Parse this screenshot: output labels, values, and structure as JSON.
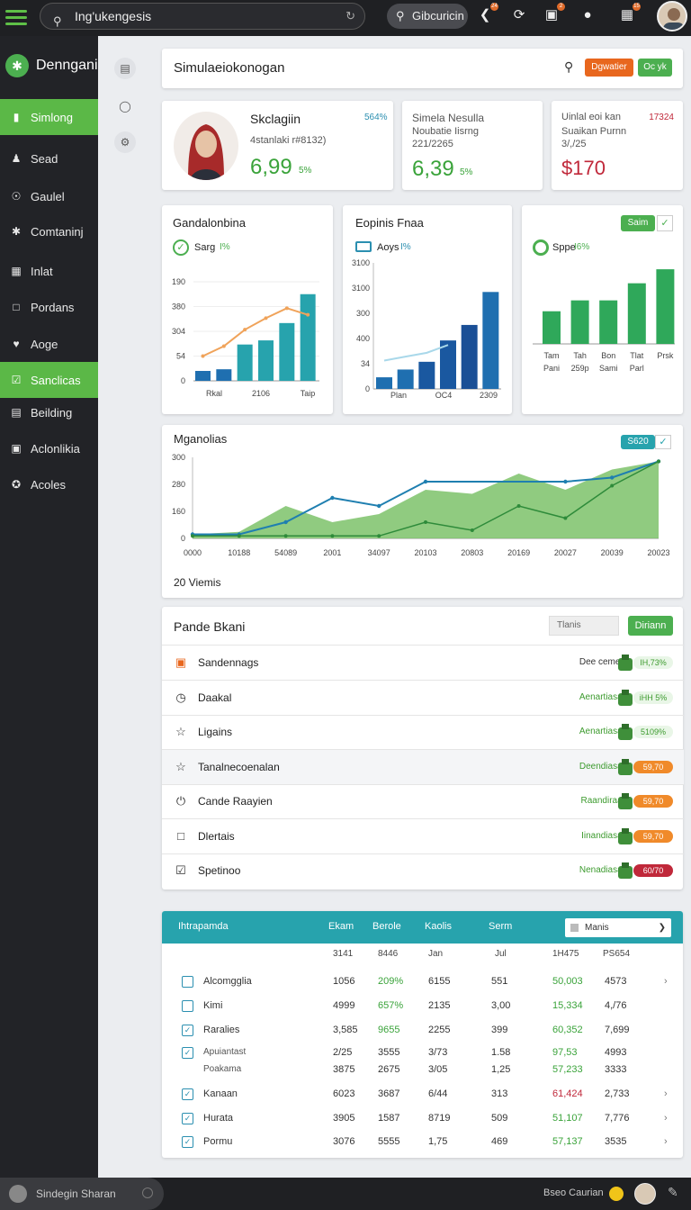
{
  "topbar": {
    "search_value": "Ing'ukengesis",
    "pill_search": "Gibcuricin",
    "badges": [
      "24",
      "2",
      "15",
      "24"
    ]
  },
  "sidebar": {
    "brand": "Denngani",
    "items": [
      {
        "label": "Simlong",
        "icon": "document-icon",
        "active": true
      },
      {
        "label": "Sead",
        "icon": "user-icon",
        "active": false
      },
      {
        "label": "Gaulel",
        "icon": "target-icon",
        "active": false
      },
      {
        "label": "Comtaninj",
        "icon": "gear-icon",
        "active": false
      },
      {
        "label": "Inlat",
        "icon": "grid-icon",
        "active": false
      },
      {
        "label": "Pordans",
        "icon": "square-icon",
        "active": false
      },
      {
        "label": "Aoge",
        "icon": "heart-icon",
        "active": false
      },
      {
        "label": "Sanclicas",
        "icon": "check-icon",
        "active": true
      },
      {
        "label": "Beilding",
        "icon": "chart-icon",
        "active": false
      },
      {
        "label": "Aclonlikia",
        "icon": "image-icon",
        "active": false
      },
      {
        "label": "Acoles",
        "icon": "star-icon",
        "active": false
      }
    ]
  },
  "header": {
    "title": "Simulaeiokonogan",
    "btn_orange": "Dgwatier",
    "btn_green": "Oc yk"
  },
  "stats": [
    {
      "title": "Skclagiin",
      "subtitle": "4stanlaki r#8132)",
      "value": "6,99",
      "pct": "5%",
      "corner": "564%",
      "value_color": "#3aa33a"
    },
    {
      "line1": "Simela Nesulla",
      "line2": "Noubatie Iisrng",
      "line3": "221/2265",
      "value": "6,39",
      "pct": "5%",
      "value_color": "#3aa33a"
    },
    {
      "line1": "Uinlal eoi kan",
      "line2": "Suaikan Purnn",
      "line3": "3/,/25",
      "value": "$170",
      "corner": "17324",
      "value_color": "#c0283a"
    }
  ],
  "chart1": {
    "title": "Gandalonbina",
    "legend": "Sarg",
    "legend_pct": "I%",
    "chart_data": {
      "type": "bar",
      "yticks": [
        "190",
        "380",
        "304",
        "54",
        "0"
      ],
      "xticks": [
        "Rkal",
        "2106",
        "Taip"
      ],
      "values": [
        12,
        14,
        44,
        49,
        70,
        105
      ],
      "line": [
        30,
        42,
        62,
        76,
        88,
        80
      ],
      "ylim": [
        0,
        120
      ]
    }
  },
  "chart2": {
    "title": "Eopinis Fnaa",
    "legend": "Aoys",
    "legend_pct": "I%",
    "chart_data": {
      "type": "bar",
      "yticks": [
        "3100",
        "3100",
        "300",
        "400",
        "34",
        "0"
      ],
      "xticks": [
        "Plan",
        "OC4",
        "2309"
      ],
      "values": [
        12,
        20,
        28,
        50,
        66,
        100
      ],
      "line": [
        20,
        24,
        28,
        36
      ],
      "ylim": [
        0,
        130
      ]
    }
  },
  "chart3": {
    "button": "Saim",
    "legend": "Sppe",
    "legend_pct": "I6%",
    "chart_data": {
      "type": "bar",
      "xticks_top": [
        "Tam",
        "Tah",
        "Bon",
        "Tlat",
        "Prsk"
      ],
      "xticks_bottom": [
        "Pani",
        "259p",
        "Sami",
        "Parl"
      ],
      "values": [
        42,
        56,
        56,
        78,
        96
      ],
      "ylim": [
        0,
        110
      ]
    }
  },
  "chart4": {
    "title": "Mganolias",
    "button": "S620",
    "footer": "20 Viemis",
    "chart_data": {
      "type": "area",
      "yticks": [
        "300",
        "280",
        "160",
        "0"
      ],
      "xticks": [
        "0000",
        "10188",
        "54089",
        "2001",
        "34097",
        "20103",
        "20803",
        "20169",
        "20027",
        "20039",
        "20023"
      ],
      "area": [
        5,
        8,
        40,
        20,
        30,
        60,
        55,
        80,
        60,
        85,
        95
      ],
      "line_blue": [
        5,
        5,
        20,
        50,
        40,
        70,
        null,
        null,
        70,
        75,
        95
      ],
      "line_green": [
        3,
        3,
        3,
        3,
        3,
        20,
        10,
        40,
        25,
        65,
        95
      ],
      "ylim": [
        0,
        100
      ]
    }
  },
  "list": {
    "title": "Pande Bkani",
    "filter": "Tlanis",
    "action": "Diriann",
    "rows": [
      {
        "label": "Sandennags",
        "status": "Dee cemens",
        "pill": "IH,73%",
        "pill_color": "#ffffff",
        "text_color": "#3d9b2f",
        "icon": "orange-square-icon"
      },
      {
        "label": "Daakal",
        "status": "Aenartiasars",
        "pill": "iHH 5%",
        "pill_color": "#ffffff",
        "text_color": "#3d9b2f",
        "icon": "clock-icon"
      },
      {
        "label": "Ligains",
        "status": "Aenartiasars",
        "pill": "5109%",
        "pill_color": "#ffffff",
        "text_color": "#3d9b2f",
        "icon": "star-icon"
      },
      {
        "label": "Tanalnecoenalan",
        "status": "Deendiasars",
        "pill": "59,70",
        "pill_color": "#f08a2a",
        "text_color": "#3d9b2f",
        "icon": "star-icon"
      },
      {
        "label": "Cande Raayien",
        "status": "Raandiraars",
        "pill": "59,70",
        "pill_color": "#f08a2a",
        "text_color": "#3d9b2f",
        "icon": "power-icon"
      },
      {
        "label": "Dlertais",
        "status": "Iinandiasars",
        "pill": "59,70",
        "pill_color": "#f08a2a",
        "text_color": "#3d9b2f",
        "icon": "square-icon"
      },
      {
        "label": "Spetinoo",
        "status": "Nenadiasars",
        "pill": "60/70",
        "pill_color": "#c0283a",
        "text_color": "#3d9b2f",
        "icon": "checkbox-icon"
      }
    ]
  },
  "table": {
    "headers": [
      "Ihtrapamda",
      "Ekam",
      "Berole",
      "Kaolis",
      "Serm"
    ],
    "filter": "Manis",
    "subheaders": [
      "3141",
      "8446",
      "Jan",
      "Jul",
      "1H475",
      "PS654"
    ],
    "rows": [
      {
        "name": "Alcomgglia",
        "c1": "1056",
        "c2": "209%",
        "c3": "6155",
        "c4": "551",
        "c5": "50,003",
        "c6": "4573",
        "c2g": true,
        "c5color": "#3aa33a",
        "arrow": true
      },
      {
        "name": "Kimi",
        "c1": "4999",
        "c2": "657%",
        "c3": "2135",
        "c4": "3,00",
        "c5": "15,334",
        "c6": "4,/76",
        "c2g": true,
        "c5color": "#3aa33a",
        "arrow": false
      },
      {
        "name": "Raralies",
        "c1": "3,585",
        "c2": "9655",
        "c3": "2255",
        "c4": "399",
        "c5": "60,352",
        "c6": "7,699",
        "c2g": true,
        "c5color": "#3aa33a",
        "arrow": false
      },
      {
        "name": "Apuiantast",
        "c1": "2/25",
        "c2": "3555",
        "c3": "3/73",
        "c4": "1.58",
        "c5": "97,53",
        "c6": "4993",
        "c2g": false,
        "c5color": "#3aa33a",
        "arrow": false
      },
      {
        "name": "Poakama",
        "c1": "3875",
        "c2": "2675",
        "c3": "3/05",
        "c4": "1,25",
        "c5": "57,233",
        "c6": "3333",
        "c2g": false,
        "c5color": "#3aa33a",
        "arrow": false
      },
      {
        "name": "Kanaan",
        "c1": "6023",
        "c2": "3687",
        "c3": "6/44",
        "c4": "313",
        "c5": "61,424",
        "c6": "2,733",
        "c2g": false,
        "c5color": "#c0283a",
        "arrow": true
      },
      {
        "name": "Hurata",
        "c1": "3905",
        "c2": "1587",
        "c3": "8719",
        "c4": "509",
        "c5": "51,107",
        "c6": "7,776",
        "c2g": false,
        "c5color": "#3aa33a",
        "arrow": true
      },
      {
        "name": "Pormu",
        "c1": "3076",
        "c2": "5555",
        "c3": "1,75",
        "c4": "469",
        "c5": "57,137",
        "c6": "3535",
        "c2g": false,
        "c5color": "#3aa33a",
        "arrow": true
      }
    ]
  },
  "bottombar": {
    "user": "Sindegin Sharan",
    "right": "Bseo Caurian"
  }
}
